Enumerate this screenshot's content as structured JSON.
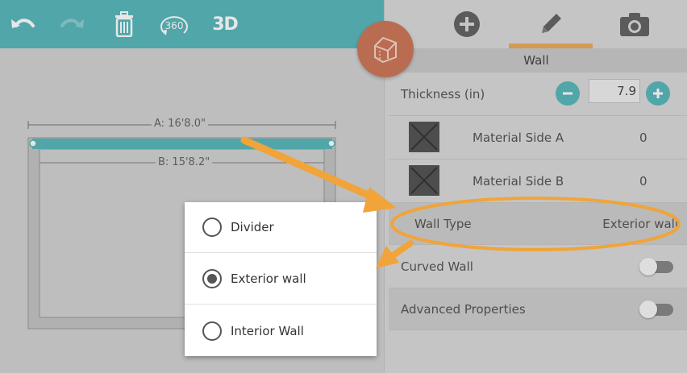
{
  "toolbar": {
    "undo_icon": "undo-icon",
    "redo_icon": "redo-icon",
    "delete_icon": "trash-icon",
    "view360_label": "360",
    "view3d_label": "3D"
  },
  "canvas": {
    "dimension_a": "A: 16'8.0\"",
    "dimension_b": "B: 15'8.2\""
  },
  "panel": {
    "tabs": [
      {
        "icon": "plus-icon",
        "active": false
      },
      {
        "icon": "pencil-icon",
        "active": true
      },
      {
        "icon": "camera-icon",
        "active": false
      }
    ],
    "title": "Wall",
    "thickness": {
      "label": "Thickness (in)",
      "value": "7.9"
    },
    "material_a": {
      "label": "Material Side A",
      "value": "0"
    },
    "material_b": {
      "label": "Material Side B",
      "value": "0"
    },
    "wall_type": {
      "label": "Wall Type",
      "value": "Exterior wall"
    },
    "curved_wall": {
      "label": "Curved Wall",
      "on": false
    },
    "advanced": {
      "label": "Advanced Properties",
      "on": false
    }
  },
  "popup": {
    "options": [
      {
        "label": "Divider",
        "checked": false
      },
      {
        "label": "Exterior wall",
        "checked": true
      },
      {
        "label": "Interior Wall",
        "checked": false
      }
    ]
  },
  "colors": {
    "accent": "#48b0b4",
    "home_button": "#c96a49",
    "annotation": "#f0a43a",
    "tab_underline": "#e8a24a"
  }
}
